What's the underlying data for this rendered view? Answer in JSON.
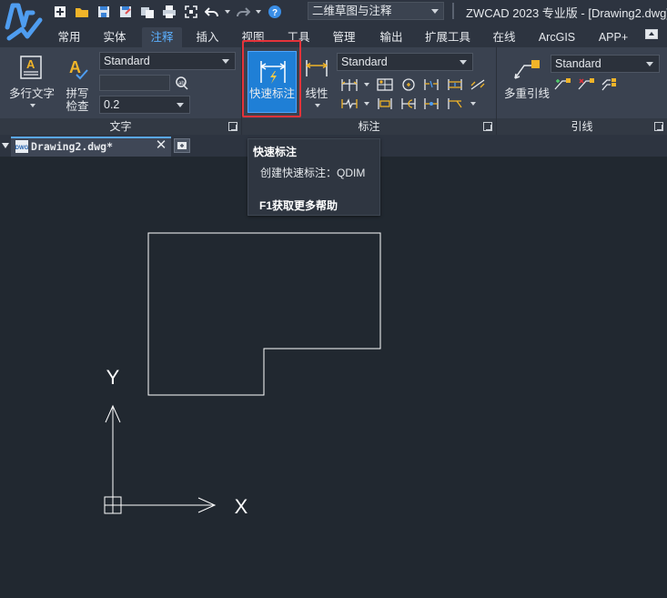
{
  "window": {
    "title": "ZWCAD 2023 专业版 - [Drawing2.dwg]",
    "workspace": "二维草图与注释"
  },
  "tabs": [
    {
      "label": "常用"
    },
    {
      "label": "实体"
    },
    {
      "label": "注释",
      "active": true
    },
    {
      "label": "插入"
    },
    {
      "label": "视图"
    },
    {
      "label": "工具"
    },
    {
      "label": "管理"
    },
    {
      "label": "输出"
    },
    {
      "label": "扩展工具"
    },
    {
      "label": "在线"
    },
    {
      "label": "ArcGIS"
    },
    {
      "label": "APP+"
    }
  ],
  "ribbon": {
    "text_panel": {
      "title": "文字",
      "mtext_label": "多行文字",
      "spell_label_1": "拼写",
      "spell_label_2": "检查",
      "style_value": "Standard",
      "find_value": "",
      "height_value": "0.2"
    },
    "dim_panel": {
      "title": "标注",
      "qdim_label": "快速标注",
      "linear_label": "线性",
      "style_value": "Standard"
    },
    "leader_panel": {
      "title": "引线",
      "mleader_label": "多重引线",
      "style_value": "Standard"
    }
  },
  "document": {
    "tab_label": "Drawing2.dwg*"
  },
  "tooltip": {
    "title": "快速标注",
    "description": "创建快速标注：QDIM",
    "help": "F1获取更多帮助"
  },
  "canvas": {
    "ucs_x_label": "X",
    "ucs_y_label": "Y"
  },
  "colors": {
    "accent": "#1f7fd6",
    "active_tab_text": "#5bb0ff",
    "highlight_box": "#e5333a",
    "canvas_bg": "#212830"
  }
}
